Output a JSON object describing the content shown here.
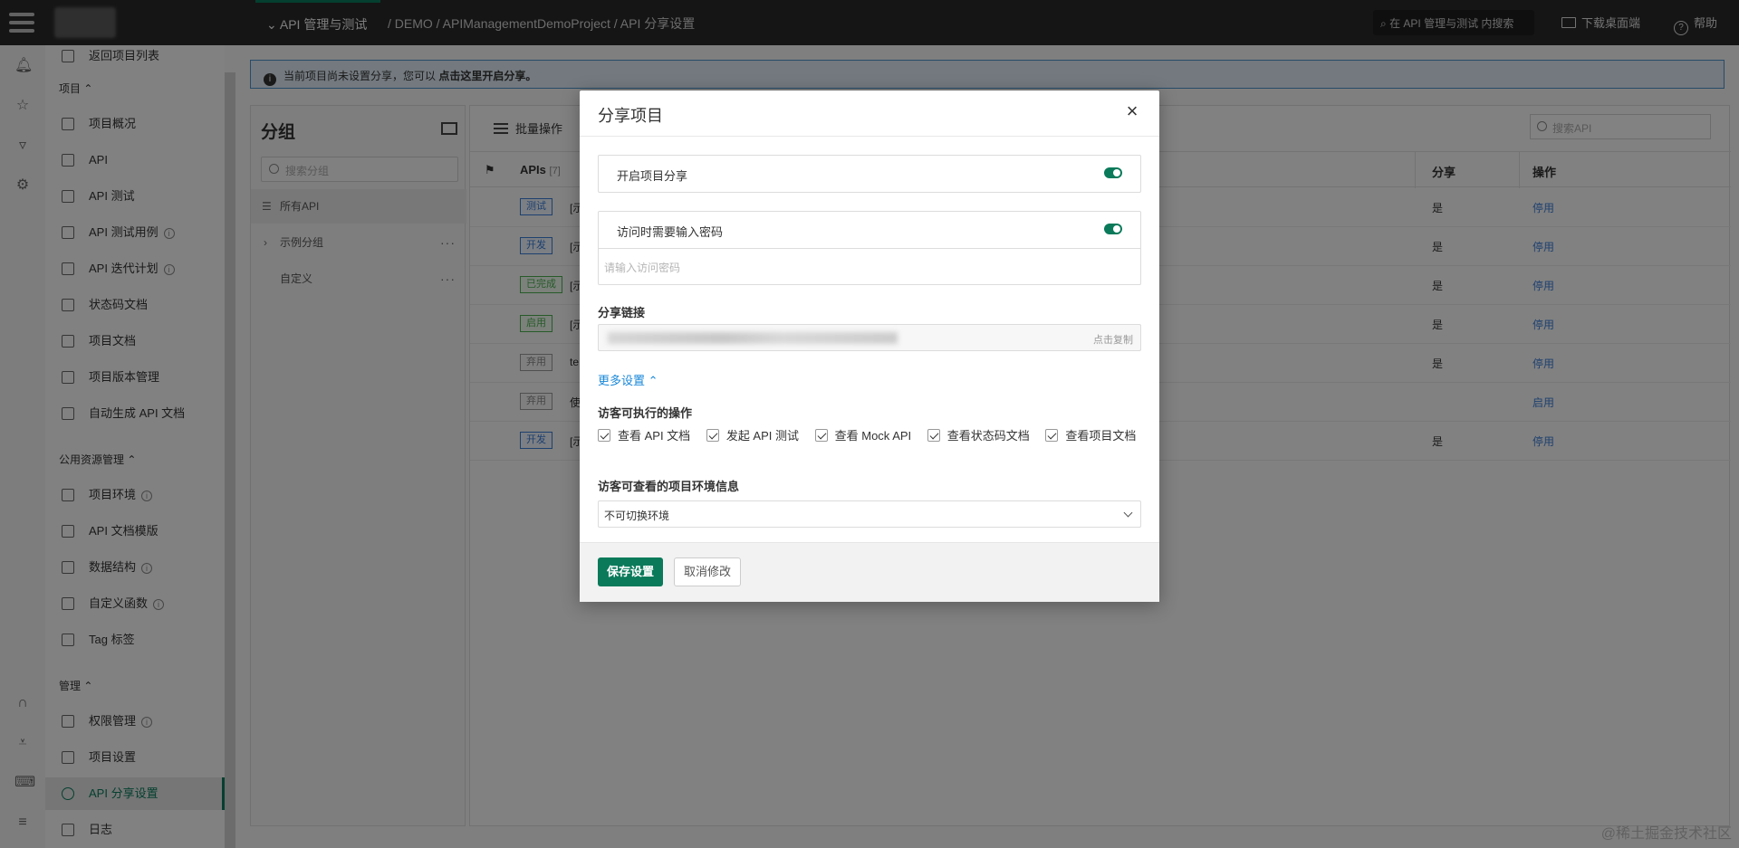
{
  "topbar": {
    "module": "API 管理与测试",
    "breadcrumb": "/ DEMO / APIManagementDemoProject / API 分享设置",
    "search_placeholder": "在 API 管理与测试 内搜索",
    "download": "下载桌面端",
    "help": "帮助",
    "accent": "#0a7a5a"
  },
  "nav": {
    "back": "返回项目列表",
    "section_project": "项目",
    "project_items": [
      "项目概况",
      "API",
      "API 测试",
      "API 测试用例",
      "API 迭代计划",
      "状态码文档",
      "项目文档",
      "项目版本管理",
      "自动生成 API 文档"
    ],
    "section_public": "公用资源管理",
    "public_items": [
      "项目环境",
      "API 文档模版",
      "数据结构",
      "自定义函数",
      "Tag 标签"
    ],
    "section_manage": "管理",
    "manage_items": [
      "权限管理",
      "项目设置",
      "API 分享设置",
      "日志"
    ]
  },
  "notice": {
    "text": "当前项目尚未设置分享，您可以",
    "action": "点击这里开启分享。"
  },
  "group": {
    "title": "分组",
    "search_placeholder": "搜索分组",
    "items": [
      "所有API",
      "示例分组",
      "自定义"
    ]
  },
  "table": {
    "bulk": "批量操作",
    "search_placeholder": "搜索API",
    "col_apis": "APIs",
    "col_count": "[7]",
    "col_share": "分享",
    "col_op": "操作",
    "rows": [
      {
        "tag": "测试",
        "name": "[示",
        "share": "是",
        "op": "停用"
      },
      {
        "tag": "开发",
        "name": "[示",
        "share": "是",
        "op": "停用"
      },
      {
        "tag": "已完成",
        "name": "[示",
        "share": "是",
        "op": "停用"
      },
      {
        "tag": "启用",
        "name": "[示",
        "share": "是",
        "op": "停用"
      },
      {
        "tag": "弃用",
        "name": "te",
        "share": "是",
        "op": "停用"
      },
      {
        "tag": "弃用",
        "name": "使",
        "share": "",
        "op": "启用"
      },
      {
        "tag": "开发",
        "name": "[示",
        "share": "是",
        "op": "停用"
      }
    ]
  },
  "modal": {
    "title": "分享项目",
    "enable_share": "开启项目分享",
    "need_password": "访问时需要输入密码",
    "password_placeholder": "请输入访问密码",
    "link_label": "分享链接",
    "copy": "点击复制",
    "more_settings": "更多设置",
    "ops_label": "访客可执行的操作",
    "ops": [
      "查看 API 文档",
      "发起 API 测试",
      "查看 Mock API",
      "查看状态码文档",
      "查看项目文档"
    ],
    "env_label": "访客可查看的项目环境信息",
    "env_value": "不可切换环境",
    "save": "保存设置",
    "cancel": "取消修改"
  },
  "watermark": "@稀土掘金技术社区"
}
